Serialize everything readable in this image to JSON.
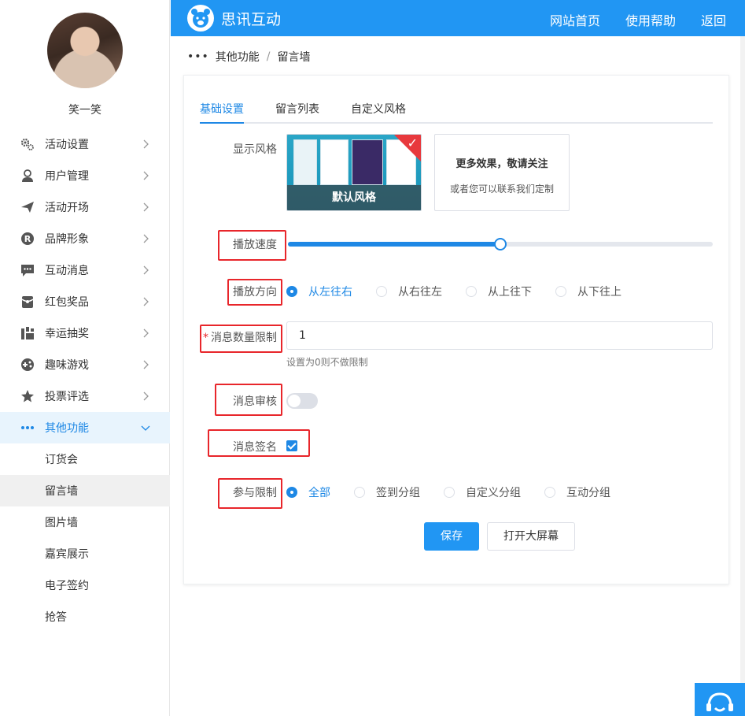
{
  "user": {
    "name": "笑一笑"
  },
  "sidebar": {
    "items": [
      {
        "label": "活动设置",
        "icon": "gears-icon"
      },
      {
        "label": "用户管理",
        "icon": "user-icon"
      },
      {
        "label": "活动开场",
        "icon": "paper-plane-icon"
      },
      {
        "label": "品牌形象",
        "icon": "registered-icon"
      },
      {
        "label": "互动消息",
        "icon": "chat-icon"
      },
      {
        "label": "红包奖品",
        "icon": "red-packet-icon"
      },
      {
        "label": "幸运抽奖",
        "icon": "lottery-icon"
      },
      {
        "label": "趣味游戏",
        "icon": "gamepad-icon"
      },
      {
        "label": "投票评选",
        "icon": "star-icon"
      },
      {
        "label": "其他功能",
        "icon": "more-dots-icon"
      }
    ],
    "subitems": [
      "订货会",
      "留言墙",
      "图片墙",
      "嘉宾展示",
      "电子签约",
      "抢答"
    ]
  },
  "header": {
    "brand": "思讯互动",
    "nav": [
      "网站首页",
      "使用帮助",
      "返回"
    ]
  },
  "breadcrumb": {
    "parent": "其他功能",
    "current": "留言墙"
  },
  "tabs": [
    "基础设置",
    "留言列表",
    "自定义风格"
  ],
  "form": {
    "display_style_label": "显示风格",
    "style_default_caption": "默认风格",
    "more_title": "更多效果，敬请关注",
    "more_sub": "或者您可以联系我们定制",
    "speed_label": "播放速度",
    "speed_value": 0.5,
    "direction_label": "播放方向",
    "directions": [
      "从左往右",
      "从右往左",
      "从上往下",
      "从下往上"
    ],
    "limit_label": "消息数量限制",
    "limit_required": "*",
    "limit_value": "1",
    "limit_hint": "设置为0则不做限制",
    "review_label": "消息审核",
    "review_enabled": false,
    "signature_label": "消息签名",
    "signature_checked": true,
    "participant_label": "参与限制",
    "participants": [
      "全部",
      "签到分组",
      "自定义分组",
      "互动分组"
    ]
  },
  "buttons": {
    "save": "保存",
    "open_screen": "打开大屏幕"
  },
  "colors": {
    "primary": "#2196f3",
    "highlight": "#e8262b"
  }
}
